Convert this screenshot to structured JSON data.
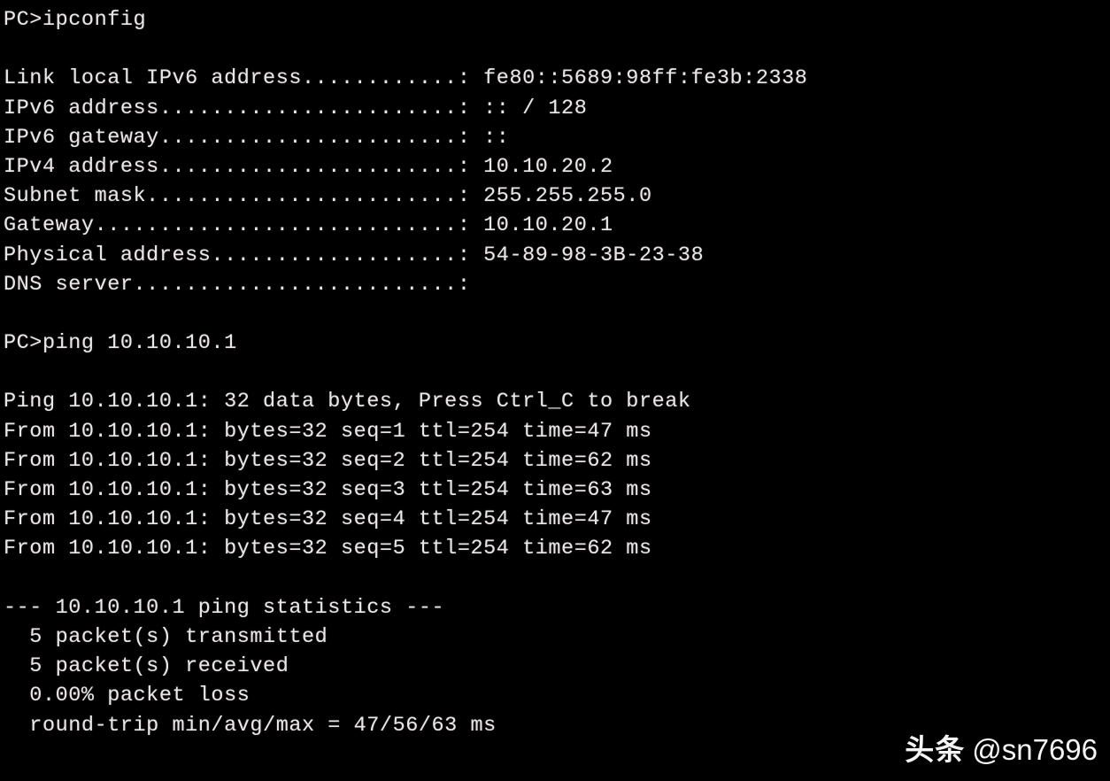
{
  "terminal": {
    "prompt": "PC>",
    "background_color": "#000000",
    "text_color": "#e8e8e8",
    "commands": [
      {
        "prompt": "PC>",
        "command": "ipconfig"
      },
      {
        "prompt": "PC>",
        "command": "ping 10.10.10.1"
      }
    ],
    "ipconfig": {
      "rows": [
        {
          "label": "Link local IPv6 address",
          "dots": 12,
          "value": "fe80::5689:98ff:fe3b:2338"
        },
        {
          "label": "IPv6 address",
          "dots": 23,
          "value": ":: / 128"
        },
        {
          "label": "IPv6 gateway",
          "dots": 23,
          "value": "::"
        },
        {
          "label": "IPv4 address",
          "dots": 23,
          "value": "10.10.20.2"
        },
        {
          "label": "Subnet mask",
          "dots": 24,
          "value": "255.255.255.0"
        },
        {
          "label": "Gateway",
          "dots": 28,
          "value": "10.10.20.1"
        },
        {
          "label": "Physical address",
          "dots": 19,
          "value": "54-89-98-3B-23-38"
        },
        {
          "label": "DNS server",
          "dots": 25,
          "value": ""
        }
      ]
    },
    "ping": {
      "header": "Ping 10.10.10.1: 32 data bytes, Press Ctrl_C to break",
      "target": "10.10.10.1",
      "data_bytes": 32,
      "break_hint": "Press Ctrl_C to break",
      "replies": [
        {
          "from": "10.10.10.1",
          "bytes": 32,
          "seq": 1,
          "ttl": 254,
          "time": 47,
          "unit": "ms",
          "text": "From 10.10.10.1: bytes=32 seq=1 ttl=254 time=47 ms"
        },
        {
          "from": "10.10.10.1",
          "bytes": 32,
          "seq": 2,
          "ttl": 254,
          "time": 62,
          "unit": "ms",
          "text": "From 10.10.10.1: bytes=32 seq=2 ttl=254 time=62 ms"
        },
        {
          "from": "10.10.10.1",
          "bytes": 32,
          "seq": 3,
          "ttl": 254,
          "time": 63,
          "unit": "ms",
          "text": "From 10.10.10.1: bytes=32 seq=3 ttl=254 time=63 ms"
        },
        {
          "from": "10.10.10.1",
          "bytes": 32,
          "seq": 4,
          "ttl": 254,
          "time": 47,
          "unit": "ms",
          "text": "From 10.10.10.1: bytes=32 seq=4 ttl=254 time=47 ms"
        },
        {
          "from": "10.10.10.1",
          "bytes": 32,
          "seq": 5,
          "ttl": 254,
          "time": 62,
          "unit": "ms",
          "text": "From 10.10.10.1: bytes=32 seq=5 ttl=254 time=62 ms"
        }
      ],
      "statistics": {
        "header": "--- 10.10.10.1 ping statistics ---",
        "transmitted": "  5 packet(s) transmitted",
        "received": "  5 packet(s) received",
        "loss": "  0.00% packet loss",
        "round_trip": "  round-trip min/avg/max = 47/56/63 ms",
        "min_ms": 47,
        "avg_ms": 56,
        "max_ms": 63
      }
    }
  },
  "watermark": {
    "logo": "头条",
    "handle": "@sn7696"
  }
}
